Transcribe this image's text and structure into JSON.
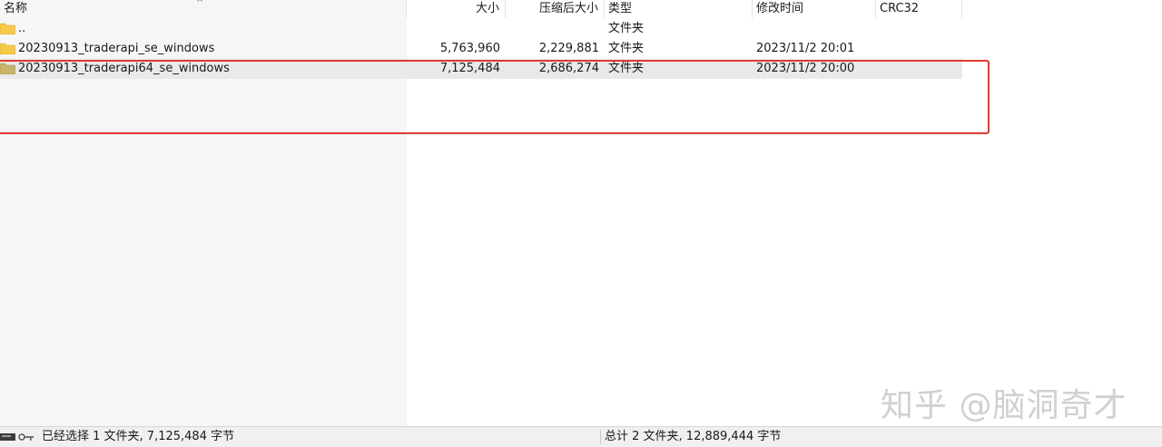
{
  "columns": {
    "name": "名称",
    "size": "大小",
    "packed": "压缩后大小",
    "type": "类型",
    "modified": "修改时间",
    "crc": "CRC32"
  },
  "rows": [
    {
      "name": "..",
      "size": "",
      "packed": "",
      "type": "文件夹",
      "modified": "",
      "selected": false
    },
    {
      "name": "20230913_traderapi_se_windows",
      "size": "5,763,960",
      "packed": "2,229,881",
      "type": "文件夹",
      "modified": "2023/11/2 20:01",
      "selected": false
    },
    {
      "name": "20230913_traderapi64_se_windows",
      "size": "7,125,484",
      "packed": "2,686,274",
      "type": "文件夹",
      "modified": "2023/11/2 20:00",
      "selected": true
    }
  ],
  "status": {
    "selection": "已经选择 1 文件夹, 7,125,484 字节",
    "total": "总计 2 文件夹, 12,889,444 字节"
  },
  "watermark": "知乎 @脑洞奇才",
  "icons": [
    "folder-icon",
    "disk-icon",
    "key-icon"
  ],
  "colors": {
    "highlight": "#e23a2f",
    "folder": "#f7c948",
    "selected_row": "#e9e9e9"
  }
}
